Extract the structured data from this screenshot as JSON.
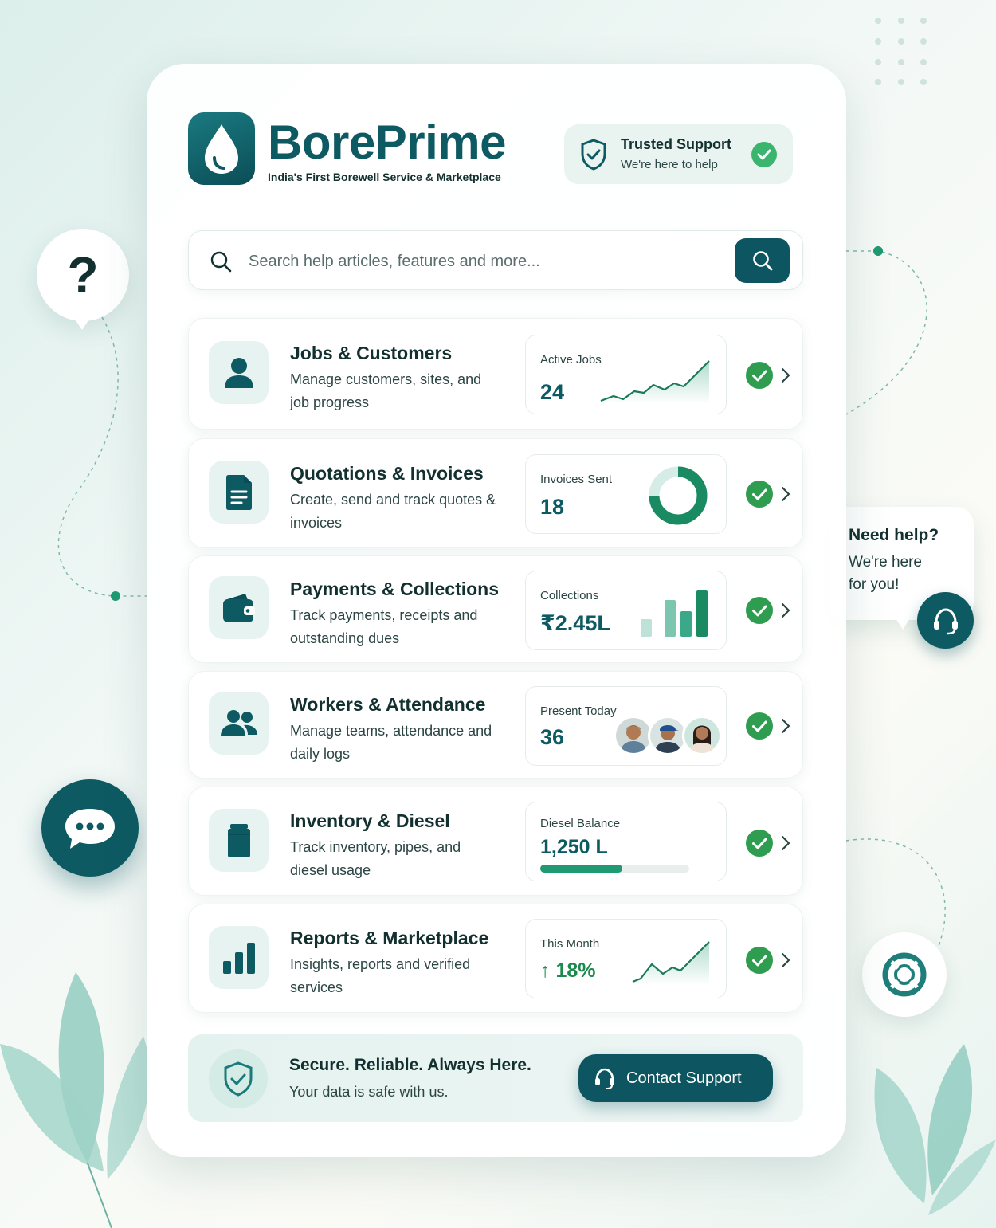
{
  "brand": {
    "name": "BorePrime",
    "tagline": "India's First Borewell Service & Marketplace"
  },
  "trusted_support": {
    "title": "Trusted Support",
    "subtitle": "We're here to help"
  },
  "search": {
    "placeholder": "Search help articles, features and more..."
  },
  "rows": [
    {
      "title": "Jobs & Customers",
      "desc": "Manage customers, sites, and job progress",
      "stat_label": "Active Jobs",
      "stat_value": "24",
      "icon": "person-icon",
      "widget": "line-chart"
    },
    {
      "title": "Quotations & Invoices",
      "desc": "Create, send and track quotes & invoices",
      "stat_label": "Invoices Sent",
      "stat_value": "18",
      "icon": "document-icon",
      "widget": "donut-chart"
    },
    {
      "title": "Payments & Collections",
      "desc": "Track payments, receipts and outstanding dues",
      "stat_label": "Collections",
      "stat_value": "₹2.45L",
      "icon": "wallet-icon",
      "widget": "bar-chart"
    },
    {
      "title": "Workers & Attendance",
      "desc": "Manage teams, attendance and daily logs",
      "stat_label": "Present Today",
      "stat_value": "36",
      "icon": "team-icon",
      "widget": "avatars"
    },
    {
      "title": "Inventory & Diesel",
      "desc": "Track inventory, pipes, and diesel usage",
      "stat_label": "Diesel Balance",
      "stat_value": "1,250 L",
      "icon": "jerrycan-icon",
      "widget": "progress",
      "progress": 0.55
    },
    {
      "title": "Reports & Marketplace",
      "desc": "Insights, reports and verified services",
      "stat_label": "This Month",
      "stat_value": "↑ 18%",
      "icon": "bar-chart-icon",
      "widget": "line-chart"
    }
  ],
  "need_help": {
    "title": "Need help?",
    "subtitle": "We're here for you!"
  },
  "footer": {
    "title": "Secure. Reliable. Always Here.",
    "subtitle": "Your data is safe with us.",
    "cta": "Contact Support"
  },
  "colors": {
    "primary": "#0e5a63",
    "accent_green": "#2e9d4f",
    "chart_green": "#1f9a72",
    "icon_bg": "#e7f3f1"
  }
}
